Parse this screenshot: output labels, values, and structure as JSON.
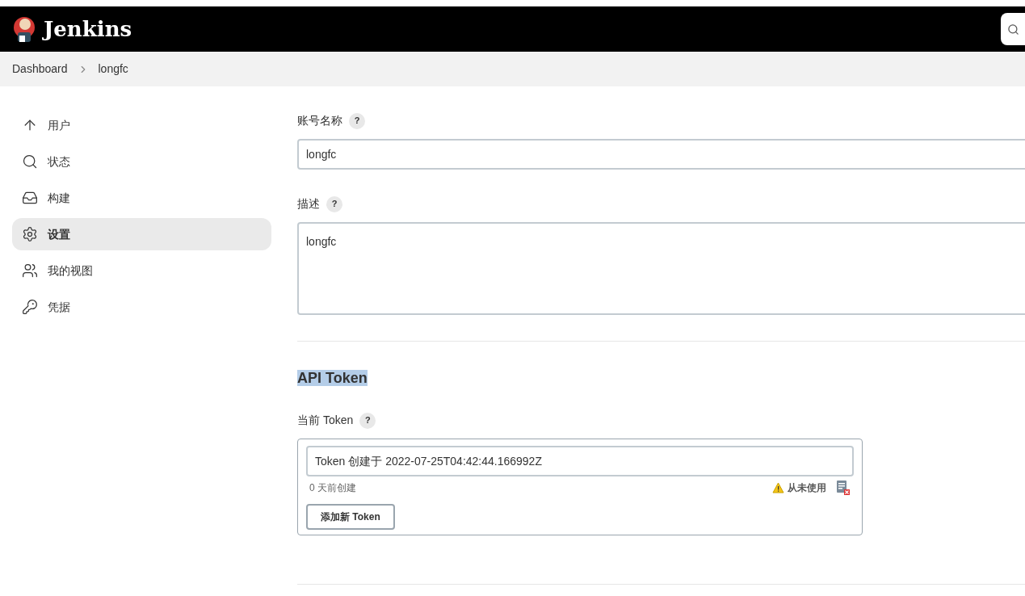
{
  "header": {
    "brand": "Jenkins"
  },
  "breadcrumbs": [
    "Dashboard",
    "longfc"
  ],
  "sidebar": {
    "items": [
      {
        "label": "用户",
        "selected": false
      },
      {
        "label": "状态",
        "selected": false
      },
      {
        "label": "构建",
        "selected": false
      },
      {
        "label": "设置",
        "selected": true
      },
      {
        "label": "我的视图",
        "selected": false
      },
      {
        "label": "凭据",
        "selected": false
      }
    ]
  },
  "form": {
    "account_name": {
      "label": "账号名称",
      "help": "?",
      "value": "longfc"
    },
    "description": {
      "label": "描述",
      "help": "?",
      "value": "longfc"
    }
  },
  "api_token": {
    "title": "API Token",
    "current_label": "当前 Token",
    "help": "?",
    "token": {
      "value": "Token 创建于 2022-07-25T04:42:44.166992Z",
      "age": "0 天前创建",
      "usage": "从未使用"
    },
    "add_button": "添加新 Token"
  }
}
